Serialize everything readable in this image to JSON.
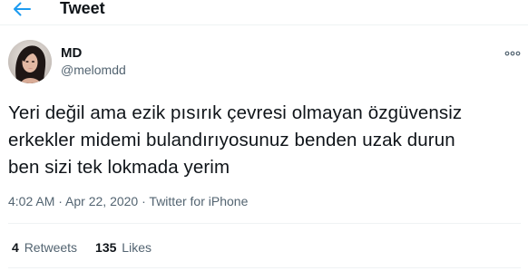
{
  "header": {
    "title": "Tweet",
    "accent_color": "#1d9bf0"
  },
  "author": {
    "name": "MD",
    "handle": "@melomdd"
  },
  "tweet": {
    "lines": [
      "Yeri değil ama ezik pısırık çevresi olmayan özgüvensiz",
      "erkekler midemi bulandırıyosunuz benden uzak durun",
      "ben sizi tek lokmada yerim"
    ]
  },
  "meta": {
    "time": "4:02 AM",
    "separator": " · ",
    "date": "Apr 22, 2020",
    "source": "Twitter for iPhone"
  },
  "stats": {
    "retweets_count": "4",
    "retweets_label": "Retweets",
    "likes_count": "135",
    "likes_label": "Likes"
  },
  "icons": {
    "back": "arrow-left-icon",
    "more": "more-horizontal-icon"
  }
}
